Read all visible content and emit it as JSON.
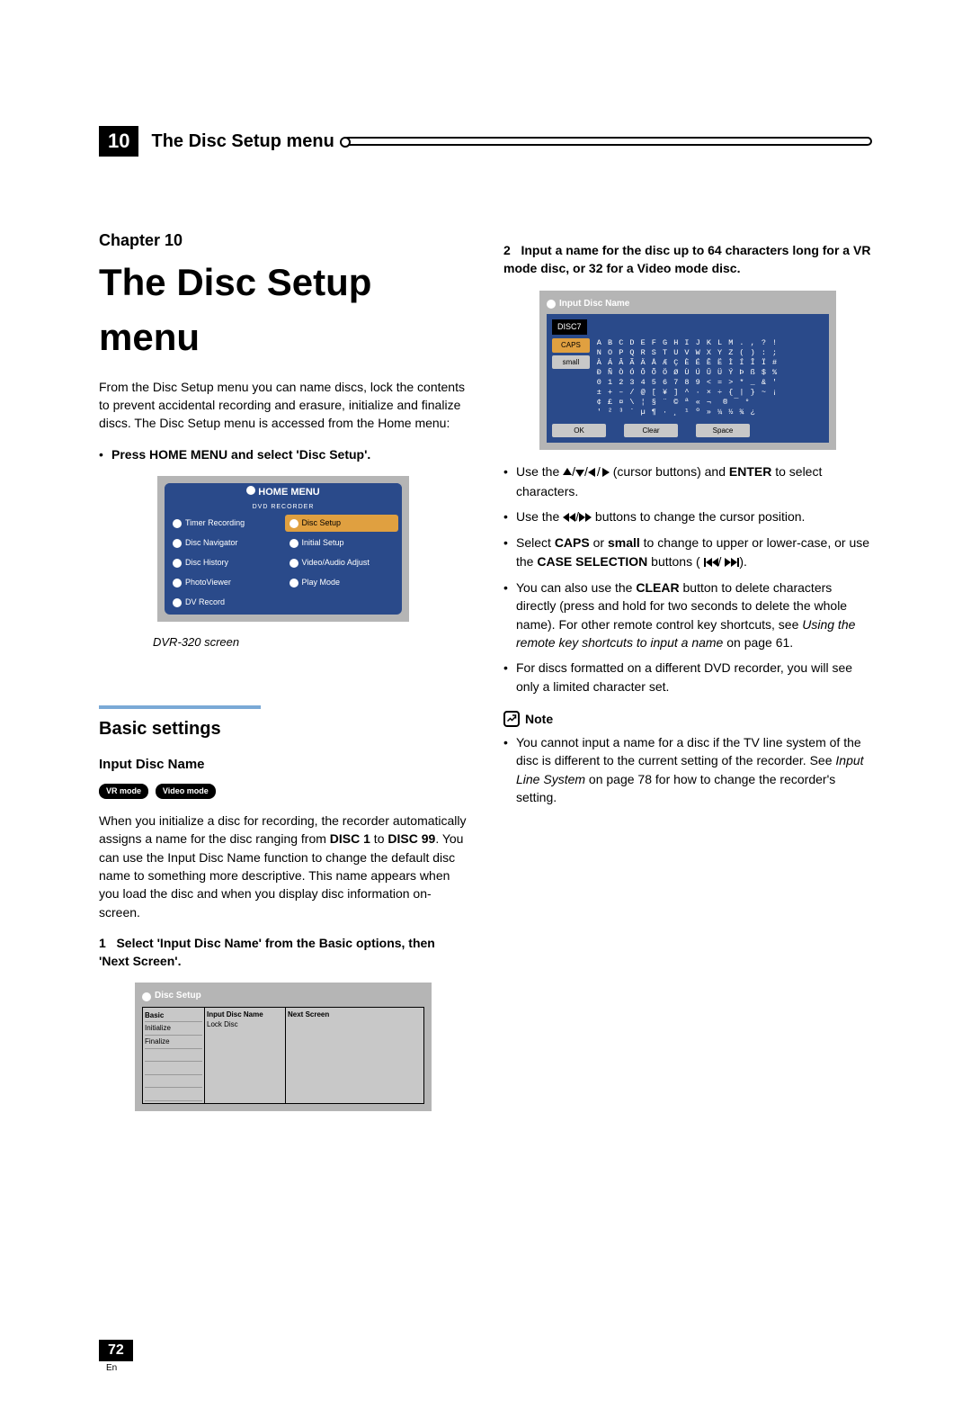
{
  "header": {
    "chapter_number": "10",
    "chapter_title": "The Disc Setup menu"
  },
  "left": {
    "chapter_label": "Chapter 10",
    "main_title": "The Disc Setup menu",
    "intro": "From the Disc Setup menu you can name discs, lock the contents to prevent accidental recording and erasure, initialize and finalize discs. The Disc Setup menu is accessed from the Home menu:",
    "step_home": "Press HOME MENU and select 'Disc Setup'.",
    "home_menu": {
      "title": "HOME MENU",
      "subtitle": "DVD RECORDER",
      "items_left": [
        "Timer Recording",
        "Disc Navigator",
        "Disc History",
        "PhotoViewer",
        "DV Record"
      ],
      "items_right": [
        "Disc Setup",
        "Initial Setup",
        "Video/Audio Adjust",
        "Play Mode"
      ]
    },
    "caption": "DVR-320 screen",
    "section_title": "Basic settings",
    "sub_title": "Input Disc Name",
    "pill1": "VR mode",
    "pill2": "Video mode",
    "para1a": "When you initialize a disc for recording, the recorder automatically assigns a name for the disc ranging from ",
    "para1b": "DISC 1",
    "para1c": " to ",
    "para1d": "DISC 99",
    "para1e": ". You can use the Input Disc Name function to change the default disc name to something more descriptive. This name appears when you load the disc and when you display disc information on-screen.",
    "step1_num": "1",
    "step1": "Select 'Input Disc Name' from the Basic options, then 'Next Screen'.",
    "disc_setup": {
      "title": "Disc Setup",
      "left": [
        "Basic",
        "Initialize",
        "Finalize"
      ],
      "mid": [
        "Input Disc Name",
        "Lock Disc"
      ],
      "right": "Next Screen"
    }
  },
  "right": {
    "step2_num": "2",
    "step2": "Input a name for the disc up to 64 characters long for a VR mode disc, or 32 for a Video mode disc.",
    "idn": {
      "title": "Input Disc Name",
      "name": "DISC7",
      "caps": "CAPS",
      "small": "small",
      "ok": "OK",
      "clear": "Clear",
      "space": "Space",
      "rows": [
        "A B C D E F G H I J K L M . , ? !",
        "N O P Q R S T U V W X Y Z ( ) : ;",
        "À Á Â Ã Ä Å Æ Ç È É Ê Ë Ì Í Î Ï #",
        "Ð Ñ Ò Ó Ô Õ Ö Ø Ù Ú Û Ü Ý Þ ß $ %",
        "0 1 2 3 4 5 6 7 8 9 < = > * _ & '",
        "± + – / @ [ ¥ ] ^ · × ÷ { | } ~ ¡",
        "¢ £ ¤ \\ ¦ § ¨ © ª « ¬ ­ ® ¯ °",
        "' ² ³ ´ µ ¶ · ¸ ¹ º » ¼ ½ ¾ ¿"
      ]
    },
    "b1a": "Use the ",
    "b1b": " (cursor buttons) and ",
    "b1c": "ENTER",
    "b1d": " to select characters.",
    "b2a": "Use the ",
    "b2b": " buttons to change the cursor position.",
    "b3a": "Select ",
    "b3b": "CAPS",
    "b3c": " or ",
    "b3d": "small",
    "b3e": " to change to upper or lower-case, or use the ",
    "b3f": "CASE SELECTION",
    "b3g": " buttons (",
    "b3h": ").",
    "b4a": "You can also use the ",
    "b4b": "CLEAR",
    "b4c": " button to delete characters directly (press and hold for two seconds to delete the whole name). For other remote control key shortcuts, see ",
    "b4d": "Using the remote key shortcuts to input a name",
    "b4e": " on page 61.",
    "b5": "For discs formatted on a different DVD recorder, you will see only a limited character set.",
    "note_label": "Note",
    "note_a": "You cannot input a name for a disc if the TV line system of the disc is different to the current setting of the recorder. See ",
    "note_b": "Input Line System",
    "note_c": " on page 78 for how to change the recorder's setting."
  },
  "footer": {
    "page": "72",
    "lang": "En"
  }
}
